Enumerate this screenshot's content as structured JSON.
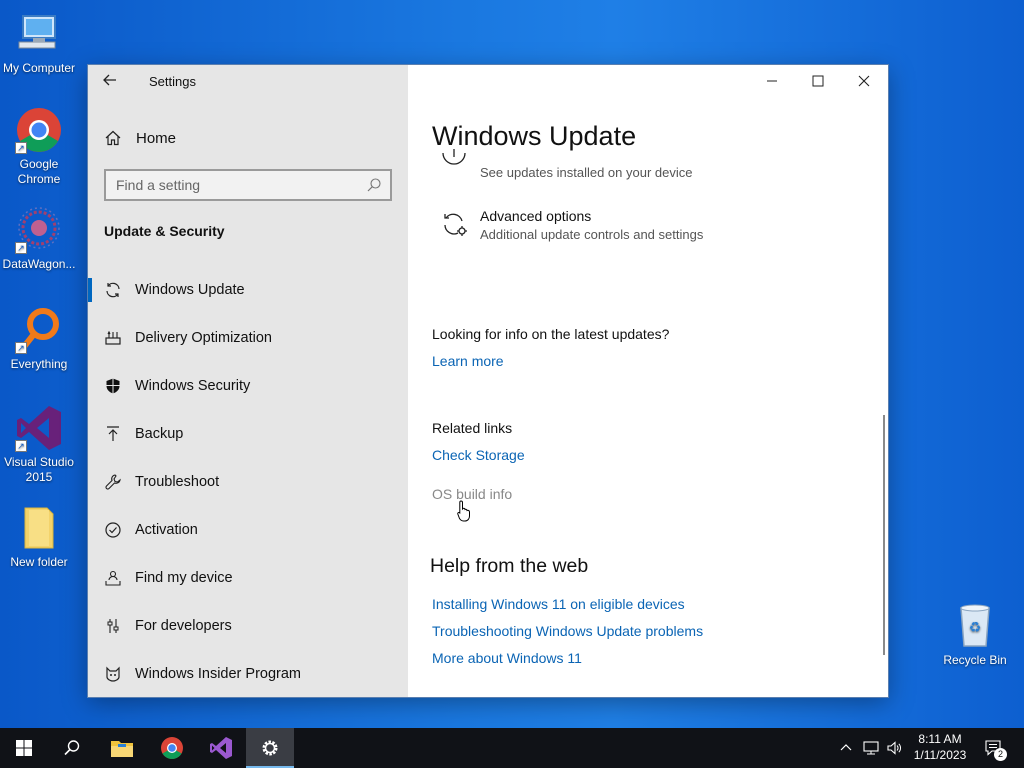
{
  "desktop": {
    "icons": [
      {
        "label": "My Computer"
      },
      {
        "label": "Google Chrome"
      },
      {
        "label": "DataWagon..."
      },
      {
        "label": "Everything"
      },
      {
        "label": "Visual Studio 2015"
      },
      {
        "label": "New folder"
      },
      {
        "label": "Recycle Bin"
      }
    ]
  },
  "window": {
    "title": "Settings",
    "home_label": "Home",
    "search_placeholder": "Find a setting",
    "section_heading": "Update & Security",
    "nav_items": [
      {
        "label": "Windows Update",
        "icon": "refresh-icon",
        "active": true
      },
      {
        "label": "Delivery Optimization",
        "icon": "delivery-icon"
      },
      {
        "label": "Windows Security",
        "icon": "shield-icon"
      },
      {
        "label": "Backup",
        "icon": "backup-arrow-icon"
      },
      {
        "label": "Troubleshoot",
        "icon": "wrench-icon"
      },
      {
        "label": "Activation",
        "icon": "check-circle-icon"
      },
      {
        "label": "Find my device",
        "icon": "person-pin-icon"
      },
      {
        "label": "For developers",
        "icon": "sliders-icon"
      },
      {
        "label": "Windows Insider Program",
        "icon": "insider-cat-icon"
      }
    ]
  },
  "content": {
    "page_title": "Windows Update",
    "update_history_desc": "See updates installed on your device",
    "advanced_options_title": "Advanced options",
    "advanced_options_desc": "Additional update controls and settings",
    "latest_info_text": "Looking for info on the latest updates?",
    "learn_more": "Learn more",
    "related_links_heading": "Related links",
    "check_storage": "Check Storage",
    "os_build_info": "OS build info",
    "help_heading": "Help from the web",
    "help_links": [
      "Installing Windows 11 on eligible devices",
      "Troubleshooting Windows Update problems",
      "More about Windows 11"
    ]
  },
  "taskbar": {
    "time": "8:11 AM",
    "date": "1/11/2023",
    "notification_count": "2",
    "apps": [
      "start-icon",
      "search-icon",
      "file-explorer-icon",
      "chrome-icon",
      "visual-studio-icon",
      "settings-gear-icon"
    ]
  },
  "colors": {
    "accent": "#0067c0",
    "link": "#0a64b4",
    "sidebar_bg": "#e6e6e6",
    "taskbar_bg": "#101217"
  }
}
